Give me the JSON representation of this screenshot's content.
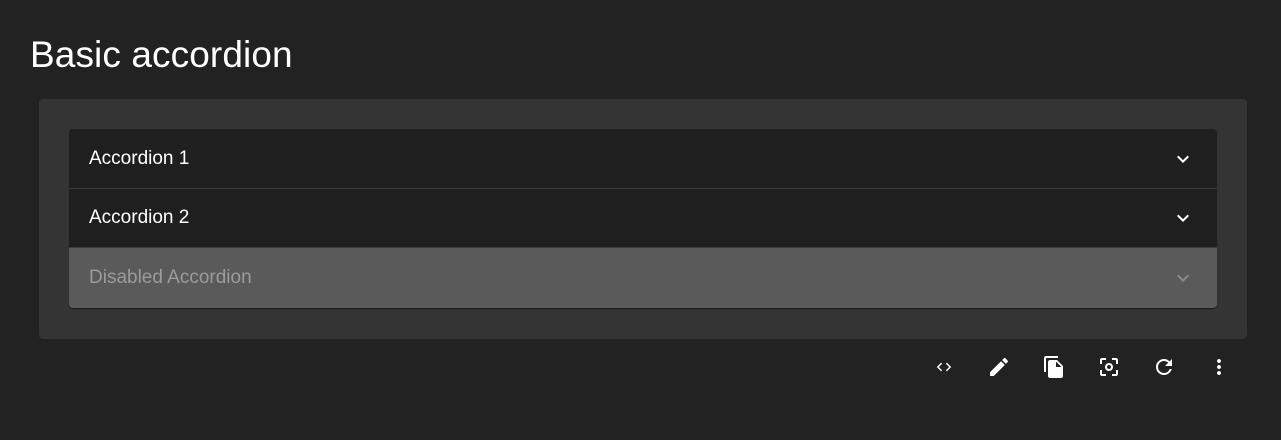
{
  "page": {
    "title": "Basic accordion"
  },
  "accordion": {
    "items": [
      {
        "label": "Accordion 1",
        "disabled": false,
        "expanded": false
      },
      {
        "label": "Accordion 2",
        "disabled": false,
        "expanded": false
      },
      {
        "label": "Disabled Accordion",
        "disabled": true,
        "expanded": false
      }
    ]
  },
  "toolbar": {
    "buttons": [
      {
        "icon": "code-icon"
      },
      {
        "icon": "edit-pencil-icon"
      },
      {
        "icon": "copy-icon"
      },
      {
        "icon": "screenshot-icon"
      },
      {
        "icon": "refresh-icon"
      },
      {
        "icon": "more-vertical-icon"
      }
    ]
  },
  "colors": {
    "background": "#222222",
    "panel": "#343434",
    "accordion_bg": "#1f1f1f",
    "disabled_bg": "#5a5a5a",
    "text": "#ffffff",
    "disabled_text": "#9b9b9b"
  }
}
